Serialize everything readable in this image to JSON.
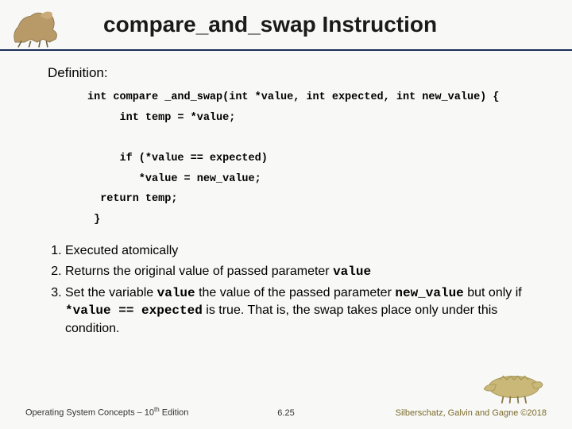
{
  "title": "compare_and_swap Instruction",
  "definition_label": "Definition:",
  "code": {
    "l1": "int compare _and_swap(int *value, int expected, int new_value) {",
    "l2": "     int temp = *value;",
    "l3": "",
    "l4": "     if (*value == expected)",
    "l5": "        *value = new_value;",
    "l6": "  return temp;",
    "l7": " }"
  },
  "list": {
    "i1": "Executed atomically",
    "i2a": "Returns the original value of passed parameter ",
    "i2b": "value",
    "i3a": "Set  the variable ",
    "i3b": "value",
    "i3c": " the value of the passed parameter ",
    "i3d": "new_value",
    "i3e": " but only if ",
    "i3f": "*value == expected",
    "i3g": " is true. That is, the swap takes place only under this condition."
  },
  "footer": {
    "left_a": "Operating System Concepts – 10",
    "left_b": "th",
    "left_c": " Edition",
    "center": "6.25",
    "right": "Silberschatz, Galvin and Gagne ©2018"
  }
}
